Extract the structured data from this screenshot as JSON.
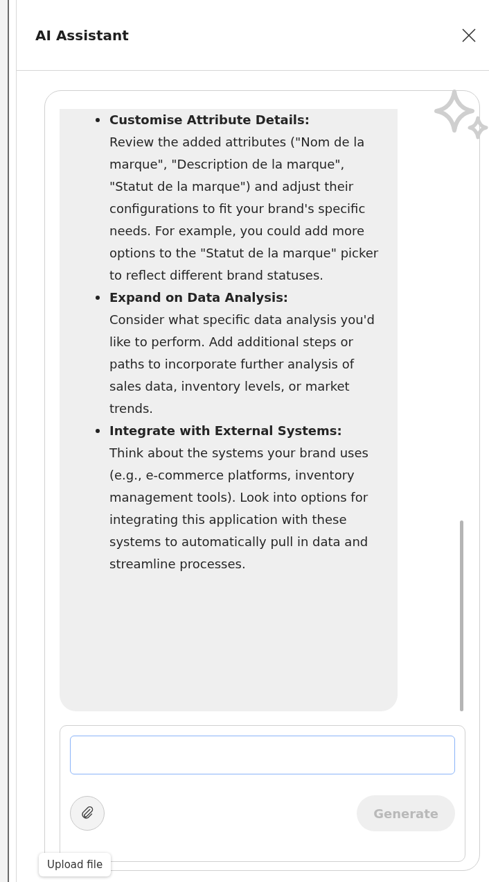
{
  "panel": {
    "title": "AI Assistant"
  },
  "message": {
    "items": [
      {
        "title": "Customise Attribute Details:",
        "body": "Review the added attributes (\"Nom de la marque\", \"Description de la marque\", \"Statut de la marque\") and adjust their configurations to fit your brand's specific needs. For example, you could add more options to the \"Statut de la marque\" picker to reflect different brand statuses."
      },
      {
        "title": "Expand on Data Analysis:",
        "body": "Consider what specific data analysis you'd like to perform. Add additional steps or paths to incorporate further analysis of sales data, inventory levels, or market trends."
      },
      {
        "title": "Integrate with External Systems:",
        "body": "Think about the systems your brand uses (e.g., e-commerce platforms, inventory management tools). Look into options for integrating this application with these systems to automatically pull in data and streamline processes."
      }
    ]
  },
  "composer": {
    "generate_button": {
      "label": "Generate",
      "disabled": true
    }
  },
  "tooltip": "Upload file"
}
